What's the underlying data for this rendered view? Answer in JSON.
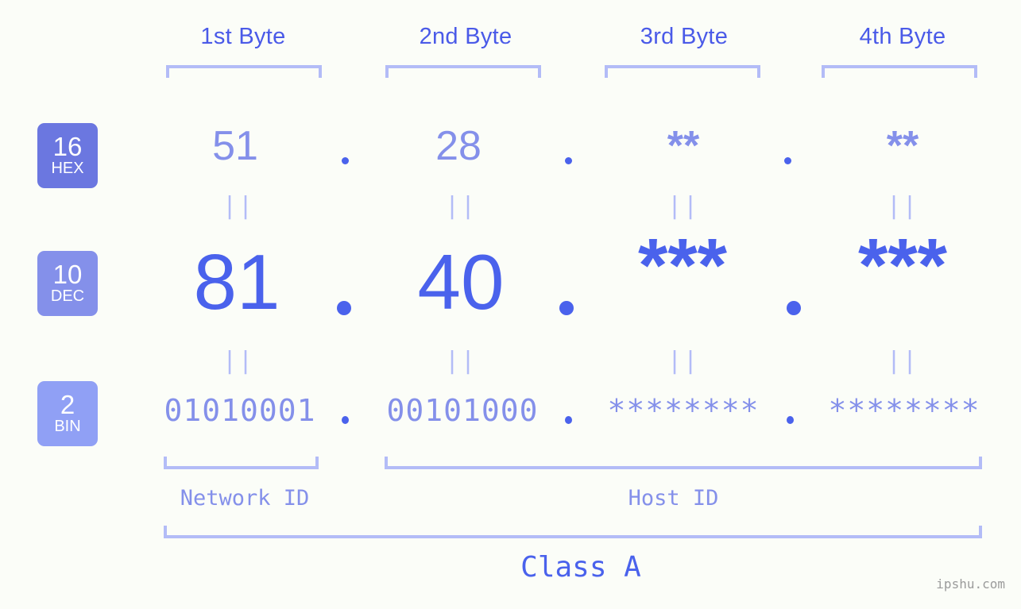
{
  "watermark": "ipshu.com",
  "byte_headers": [
    {
      "label": "1st Byte"
    },
    {
      "label": "2nd Byte"
    },
    {
      "label": "3rd Byte"
    },
    {
      "label": "4th Byte"
    }
  ],
  "bases": [
    {
      "key": "hex",
      "number": "16",
      "name": "HEX"
    },
    {
      "key": "dec",
      "number": "10",
      "name": "DEC"
    },
    {
      "key": "bin",
      "number": "2",
      "name": "BIN"
    }
  ],
  "rows": {
    "hex": {
      "values": [
        "51",
        "28",
        "**",
        "**"
      ]
    },
    "dec": {
      "values": [
        "81",
        "40",
        "***",
        "***"
      ]
    },
    "bin": {
      "values": [
        "01010001",
        "00101000",
        "********",
        "********"
      ]
    }
  },
  "separator": ".",
  "equals_mark": "||",
  "segments": {
    "network_id": "Network ID",
    "host_id": "Host ID",
    "class": "Class A"
  },
  "colors": {
    "background": "#fbfdf8",
    "byte_header_text": "#4a5ae8",
    "bracket": "#b3bcf7",
    "hex_text": "#8490ea",
    "dec_text": "#4a62ec",
    "bin_text": "#8490ea",
    "badge_hex_bg": "#6b77e0",
    "badge_dec_bg": "#8490ea",
    "badge_bin_bg": "#90a0f5",
    "watermark_text": "#9b9b9b"
  }
}
